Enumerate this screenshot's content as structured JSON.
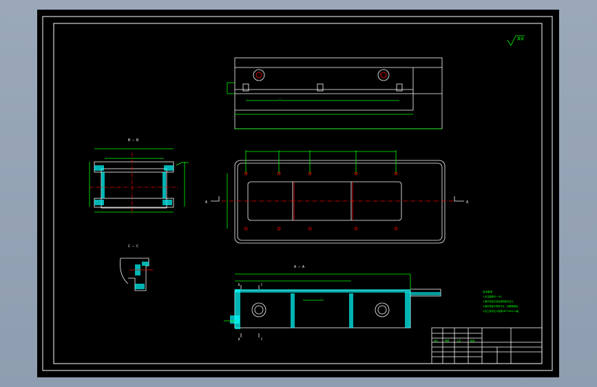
{
  "colors": {
    "background": "#000000",
    "frame": "#ffffff",
    "dimension": "#00ff00",
    "centerline": "#ff0000",
    "hatch": "#00ffff",
    "annotation": "#ffff00",
    "viewport": "#98a6b8"
  },
  "views": {
    "section_b_label": "B — B",
    "section_c_label": "C — C",
    "section_a_label": "A — A",
    "cut_mark_a": "A",
    "cut_mark_b": "B",
    "cut_mark_c": "C"
  },
  "roughness": {
    "symbol_text": "其余"
  },
  "notes": {
    "title": "技术要求",
    "lines": [
      "1.未注圆角R2~R3。",
      "2.铸件需经时效处理消除内应力。",
      "3.铸件表面不得有气孔、砂眼等缺陷。",
      "4.加工面未注公差按GB/T1804-m级。"
    ]
  },
  "title_block": {
    "marks": [
      "设计",
      "审核",
      "工艺",
      "批准"
    ]
  }
}
